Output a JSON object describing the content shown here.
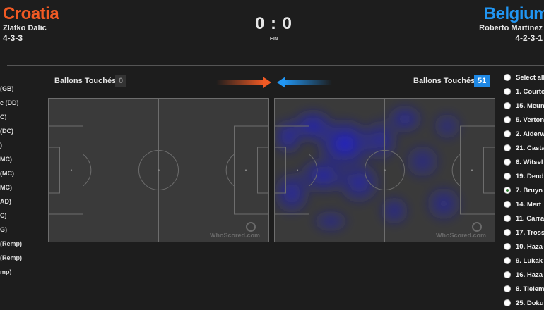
{
  "home": {
    "name": "Croatia",
    "coach": "Zlatko Dalic",
    "formation": "4-3-3",
    "color": "#f15a24",
    "touches_label": "Ballons Touchés:",
    "touches": "0"
  },
  "away": {
    "name": "Belgium",
    "coach": "Roberto Martínez",
    "formation": "4-2-3-1",
    "color": "#2196f3",
    "touches_label": "Ballons Touchés:",
    "touches": "51"
  },
  "score": "0 : 0",
  "status": "FIN",
  "watermark": "WhoScored.com",
  "home_players": [
    "(GB)",
    "c (DD)",
    "C)",
    "(DC)",
    ")",
    "MC)",
    "(MC)",
    "MC)",
    "AD)",
    "C)",
    "G)",
    "(Remp)",
    "(Remp)",
    "mp)"
  ],
  "away_players": [
    {
      "label": "Select all",
      "selected": false
    },
    {
      "label": "1. Courto",
      "selected": false
    },
    {
      "label": "15. Meun",
      "selected": false
    },
    {
      "label": "5. Verton",
      "selected": false
    },
    {
      "label": "2. Alderw",
      "selected": false
    },
    {
      "label": "21. Casta",
      "selected": false
    },
    {
      "label": "6. Witsel",
      "selected": false
    },
    {
      "label": "19. Dend",
      "selected": false
    },
    {
      "label": "7. Bruyn",
      "selected": true
    },
    {
      "label": "14. Mert",
      "selected": false
    },
    {
      "label": "11. Carra",
      "selected": false
    },
    {
      "label": "17. Tross",
      "selected": false
    },
    {
      "label": "10. Haza",
      "selected": false
    },
    {
      "label": "9. Lukak",
      "selected": false
    },
    {
      "label": "16. Haza",
      "selected": false
    },
    {
      "label": "8. Tielem",
      "selected": false
    },
    {
      "label": "25. Doku",
      "selected": false
    }
  ]
}
